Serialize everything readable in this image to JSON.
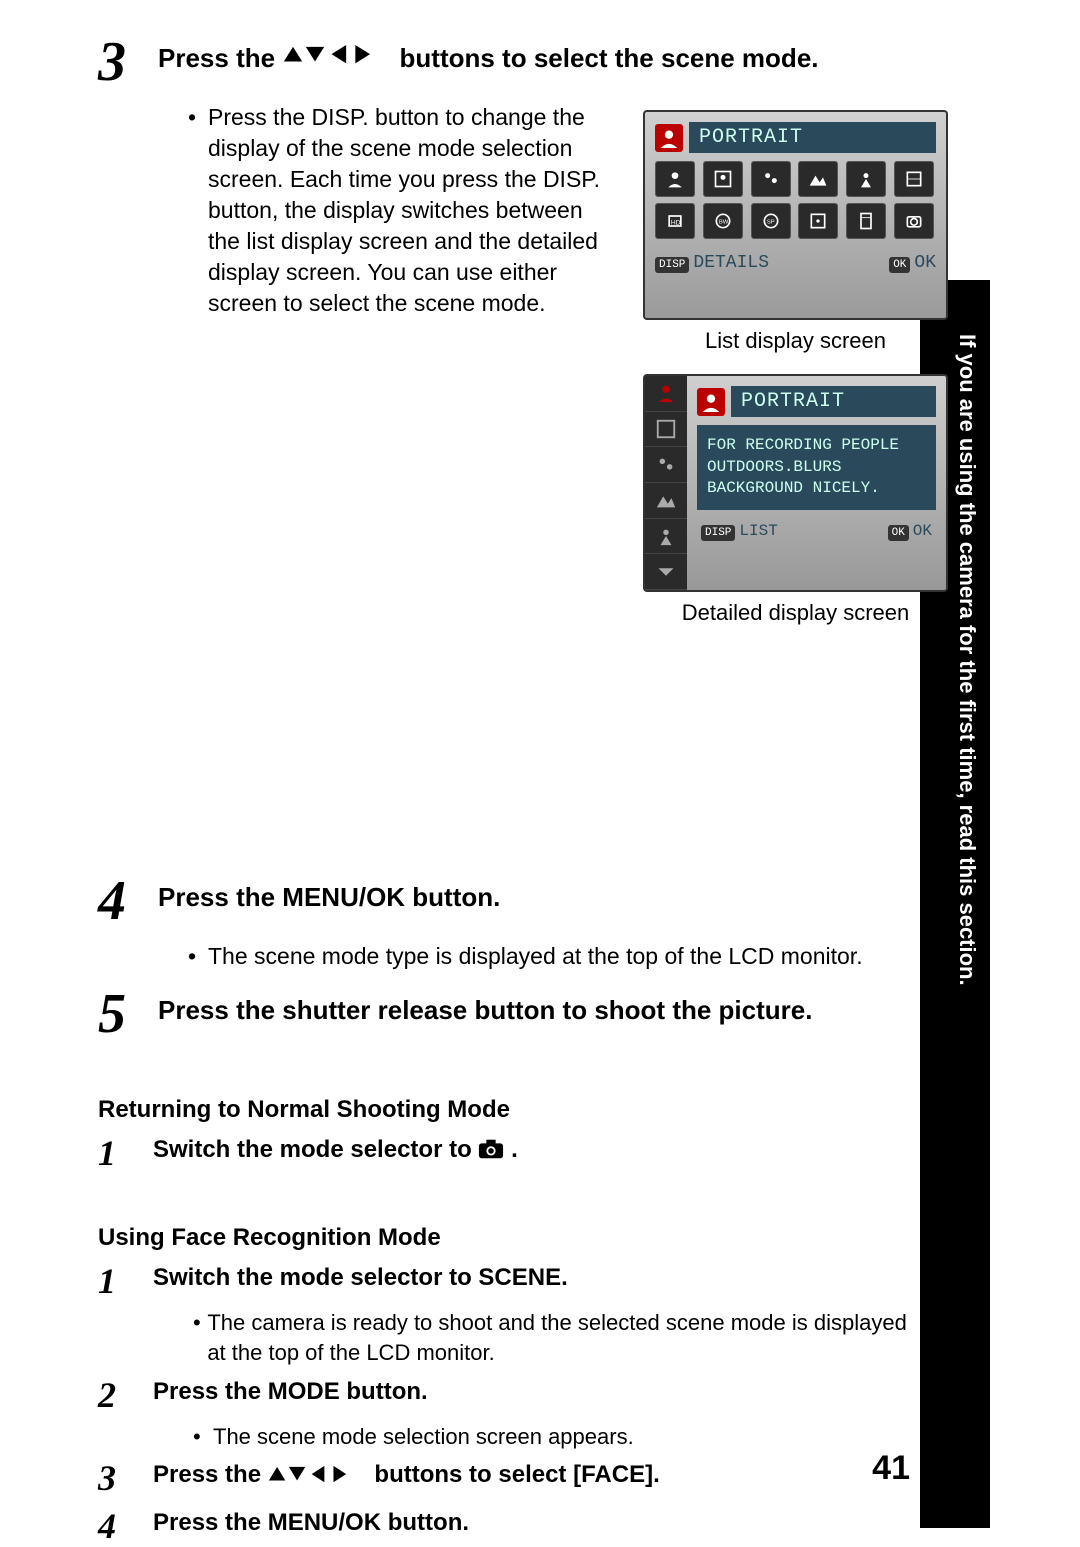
{
  "side_label": "If you are using the camera for the first time, read this section.",
  "page_number": "41",
  "step3": {
    "title_a": "Press the ",
    "title_b": " buttons to select the scene mode.",
    "bullet": "Press the DISP. button to change the display of the scene mode selection screen. Each time you press the DISP. button, the display switches between the list display screen and the detailed display screen. You can use either screen to select the scene mode."
  },
  "lcd1": {
    "title": "PORTRAIT",
    "footer_left_badge": "DISP",
    "footer_left": "DETAILS",
    "footer_right_badge": "OK",
    "footer_right": "OK",
    "caption": "List display screen"
  },
  "lcd2": {
    "title": "PORTRAIT",
    "line1": "FOR RECORDING PEOPLE",
    "line2": "OUTDOORS.BLURS",
    "line3": "BACKGROUND NICELY.",
    "footer_left_badge": "DISP",
    "footer_left": "LIST",
    "footer_right_badge": "OK",
    "footer_right": "OK",
    "caption": "Detailed display screen"
  },
  "step4": {
    "title": "Press the MENU/OK button.",
    "bullet": "The scene mode type is displayed at the top of the LCD monitor."
  },
  "step5": {
    "title": "Press the shutter release button to shoot the picture."
  },
  "return_heading": "Returning to Normal Shooting Mode",
  "return_1_a": "Switch the mode selector to ",
  "return_1_b": ".",
  "face_heading": "Using Face Recognition Mode",
  "face_1": {
    "title": "Switch the mode selector to SCENE.",
    "bullet": "The camera is ready to shoot and the selected scene mode is displayed at the top of the LCD monitor."
  },
  "face_2": {
    "title": "Press the MODE button.",
    "bullet": "The scene mode selection screen appears."
  },
  "face_3_a": "Press the ",
  "face_3_b": " buttons to select [FACE].",
  "face_4": "Press the MENU/OK button."
}
